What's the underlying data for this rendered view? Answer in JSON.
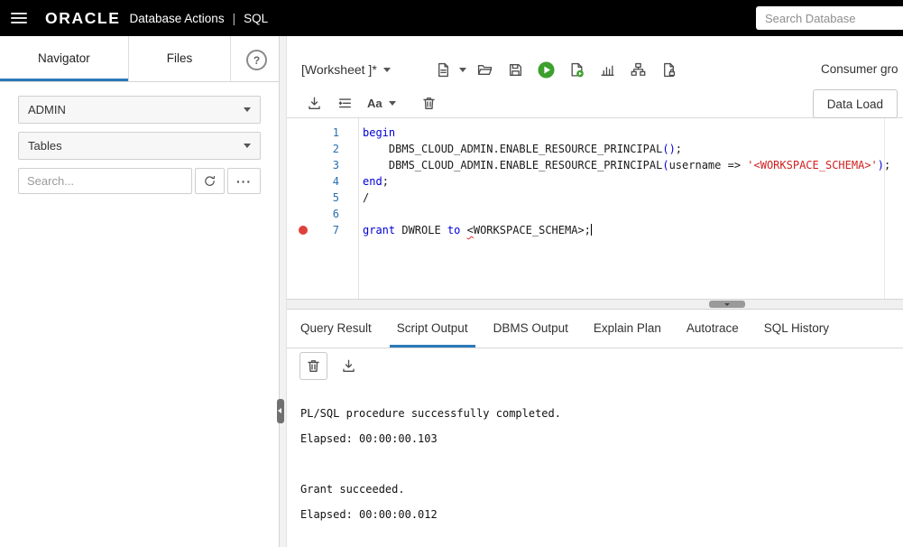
{
  "topbar": {
    "brand": "ORACLE",
    "app_title": "Database Actions",
    "separator": "|",
    "module": "SQL",
    "search_placeholder": "Search Database"
  },
  "sidebar": {
    "tabs": [
      {
        "label": "Navigator",
        "active": true
      },
      {
        "label": "Files",
        "active": false
      }
    ],
    "help_label": "?",
    "schema_selected": "ADMIN",
    "object_type_selected": "Tables",
    "search_placeholder": "Search...",
    "more_label": "···"
  },
  "worksheet": {
    "title": "[Worksheet ]*",
    "consumer_group_label": "Consumer gro",
    "data_load_label": "Data Load",
    "case_label": "Aa"
  },
  "editor": {
    "breakpoint_line": 7,
    "cursor_line": 7,
    "lines": [
      {
        "num": 1,
        "segments": [
          {
            "t": "begin",
            "c": "kw"
          }
        ]
      },
      {
        "num": 2,
        "segments": [
          {
            "t": "    DBMS_CLOUD_ADMIN.ENABLE_RESOURCE_PRINCIPAL",
            "c": ""
          },
          {
            "t": "()",
            "c": "par"
          },
          {
            "t": ";",
            "c": ""
          }
        ]
      },
      {
        "num": 3,
        "segments": [
          {
            "t": "    DBMS_CLOUD_ADMIN.ENABLE_RESOURCE_PRINCIPAL",
            "c": ""
          },
          {
            "t": "(",
            "c": "par"
          },
          {
            "t": "username => ",
            "c": ""
          },
          {
            "t": "'<WORKSPACE_SCHEMA>'",
            "c": "str"
          },
          {
            "t": ")",
            "c": "par"
          },
          {
            "t": ";",
            "c": ""
          }
        ]
      },
      {
        "num": 4,
        "segments": [
          {
            "t": "end",
            "c": "kw"
          },
          {
            "t": ";",
            "c": ""
          }
        ]
      },
      {
        "num": 5,
        "segments": [
          {
            "t": "/",
            "c": ""
          }
        ]
      },
      {
        "num": 6,
        "segments": []
      },
      {
        "num": 7,
        "segments": [
          {
            "t": "grant",
            "c": "kw"
          },
          {
            "t": " DWROLE ",
            "c": ""
          },
          {
            "t": "to",
            "c": "kw"
          },
          {
            "t": " ",
            "c": ""
          },
          {
            "t": "<",
            "c": "err"
          },
          {
            "t": "WORKSPACE_SCHEMA>;",
            "c": ""
          }
        ]
      }
    ]
  },
  "output": {
    "tabs": [
      "Query Result",
      "Script Output",
      "DBMS Output",
      "Explain Plan",
      "Autotrace",
      "SQL History"
    ],
    "active_tab": "Script Output",
    "lines": [
      "PL/SQL procedure successfully completed.",
      "Elapsed: 00:00:00.103",
      "",
      "Grant succeeded.",
      "Elapsed: 00:00:00.012"
    ]
  },
  "colors": {
    "accent_blue": "#2b7ab9",
    "topbar_bg": "#000000",
    "run_green": "#3da02c",
    "keyword_blue": "#0000d6",
    "string_red": "#d01f1f",
    "breakpoint_red": "#e0403a"
  },
  "icons": {
    "hamburger-menu-icon": "three-bars",
    "chevron-down-icon": "css-triangle",
    "help-icon": "circled-question",
    "refresh-icon": "svg-circular-arrow",
    "more-options-icon": "···",
    "new-file-icon": "svg-document",
    "open-file-icon": "svg-folder",
    "save-icon": "svg-floppy",
    "run-statement-icon": "svg-green-play-circle",
    "run-script-icon": "svg-document-green-play",
    "autotrace-icon": "svg-bar-chart",
    "explain-plan-icon": "svg-tree-diagram",
    "document-lock-icon": "svg-document-lock",
    "download-icon": "svg-arrow-into-tray",
    "format-icon": "svg-indent-lines",
    "trash-icon": "svg-trash-can",
    "breakpoint-icon": "red-dot",
    "splitter-handle": "gray-pill"
  }
}
